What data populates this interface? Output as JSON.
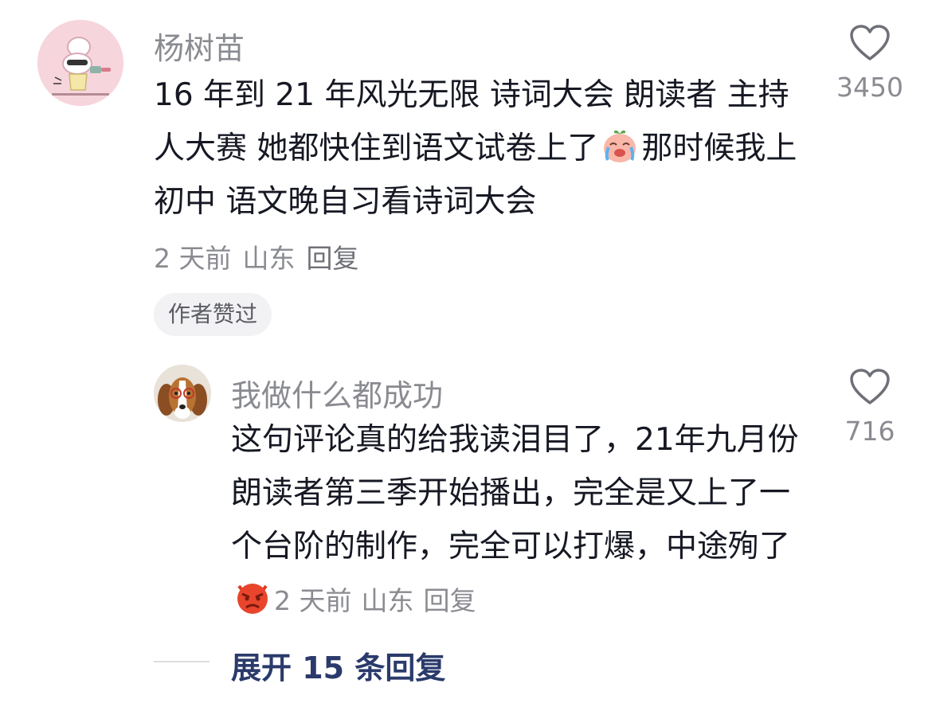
{
  "comment": {
    "author": "杨树苗",
    "text_before_emoji": "16 年到 21 年风光无限 诗词大会 朗读者 主持人大赛 她都快住到语文试卷上了",
    "text_after_emoji": "那时候我上初中 语文晚自习看诗词大会",
    "emoji": "crying-face",
    "time": "2 天前",
    "location": "山东",
    "reply_label": "回复",
    "badge": "作者赞过",
    "likes": "3450"
  },
  "reply": {
    "author": "我做什么都成功",
    "text": "这句评论真的给我读泪目了，21年九月份朗读者第三季开始播出，完全是又上了一个台阶的制作，完全可以打爆，中途殉了",
    "emoji": "angry-face",
    "time": "2 天前",
    "location": "山东",
    "reply_label": "回复",
    "likes": "716"
  },
  "expand": {
    "label": "展开 15 条回复"
  },
  "colors": {
    "primary_text": "#161823",
    "secondary_text": "#8a8b91",
    "expand_link": "#2a3a6b",
    "badge_bg": "#f2f2f4"
  }
}
